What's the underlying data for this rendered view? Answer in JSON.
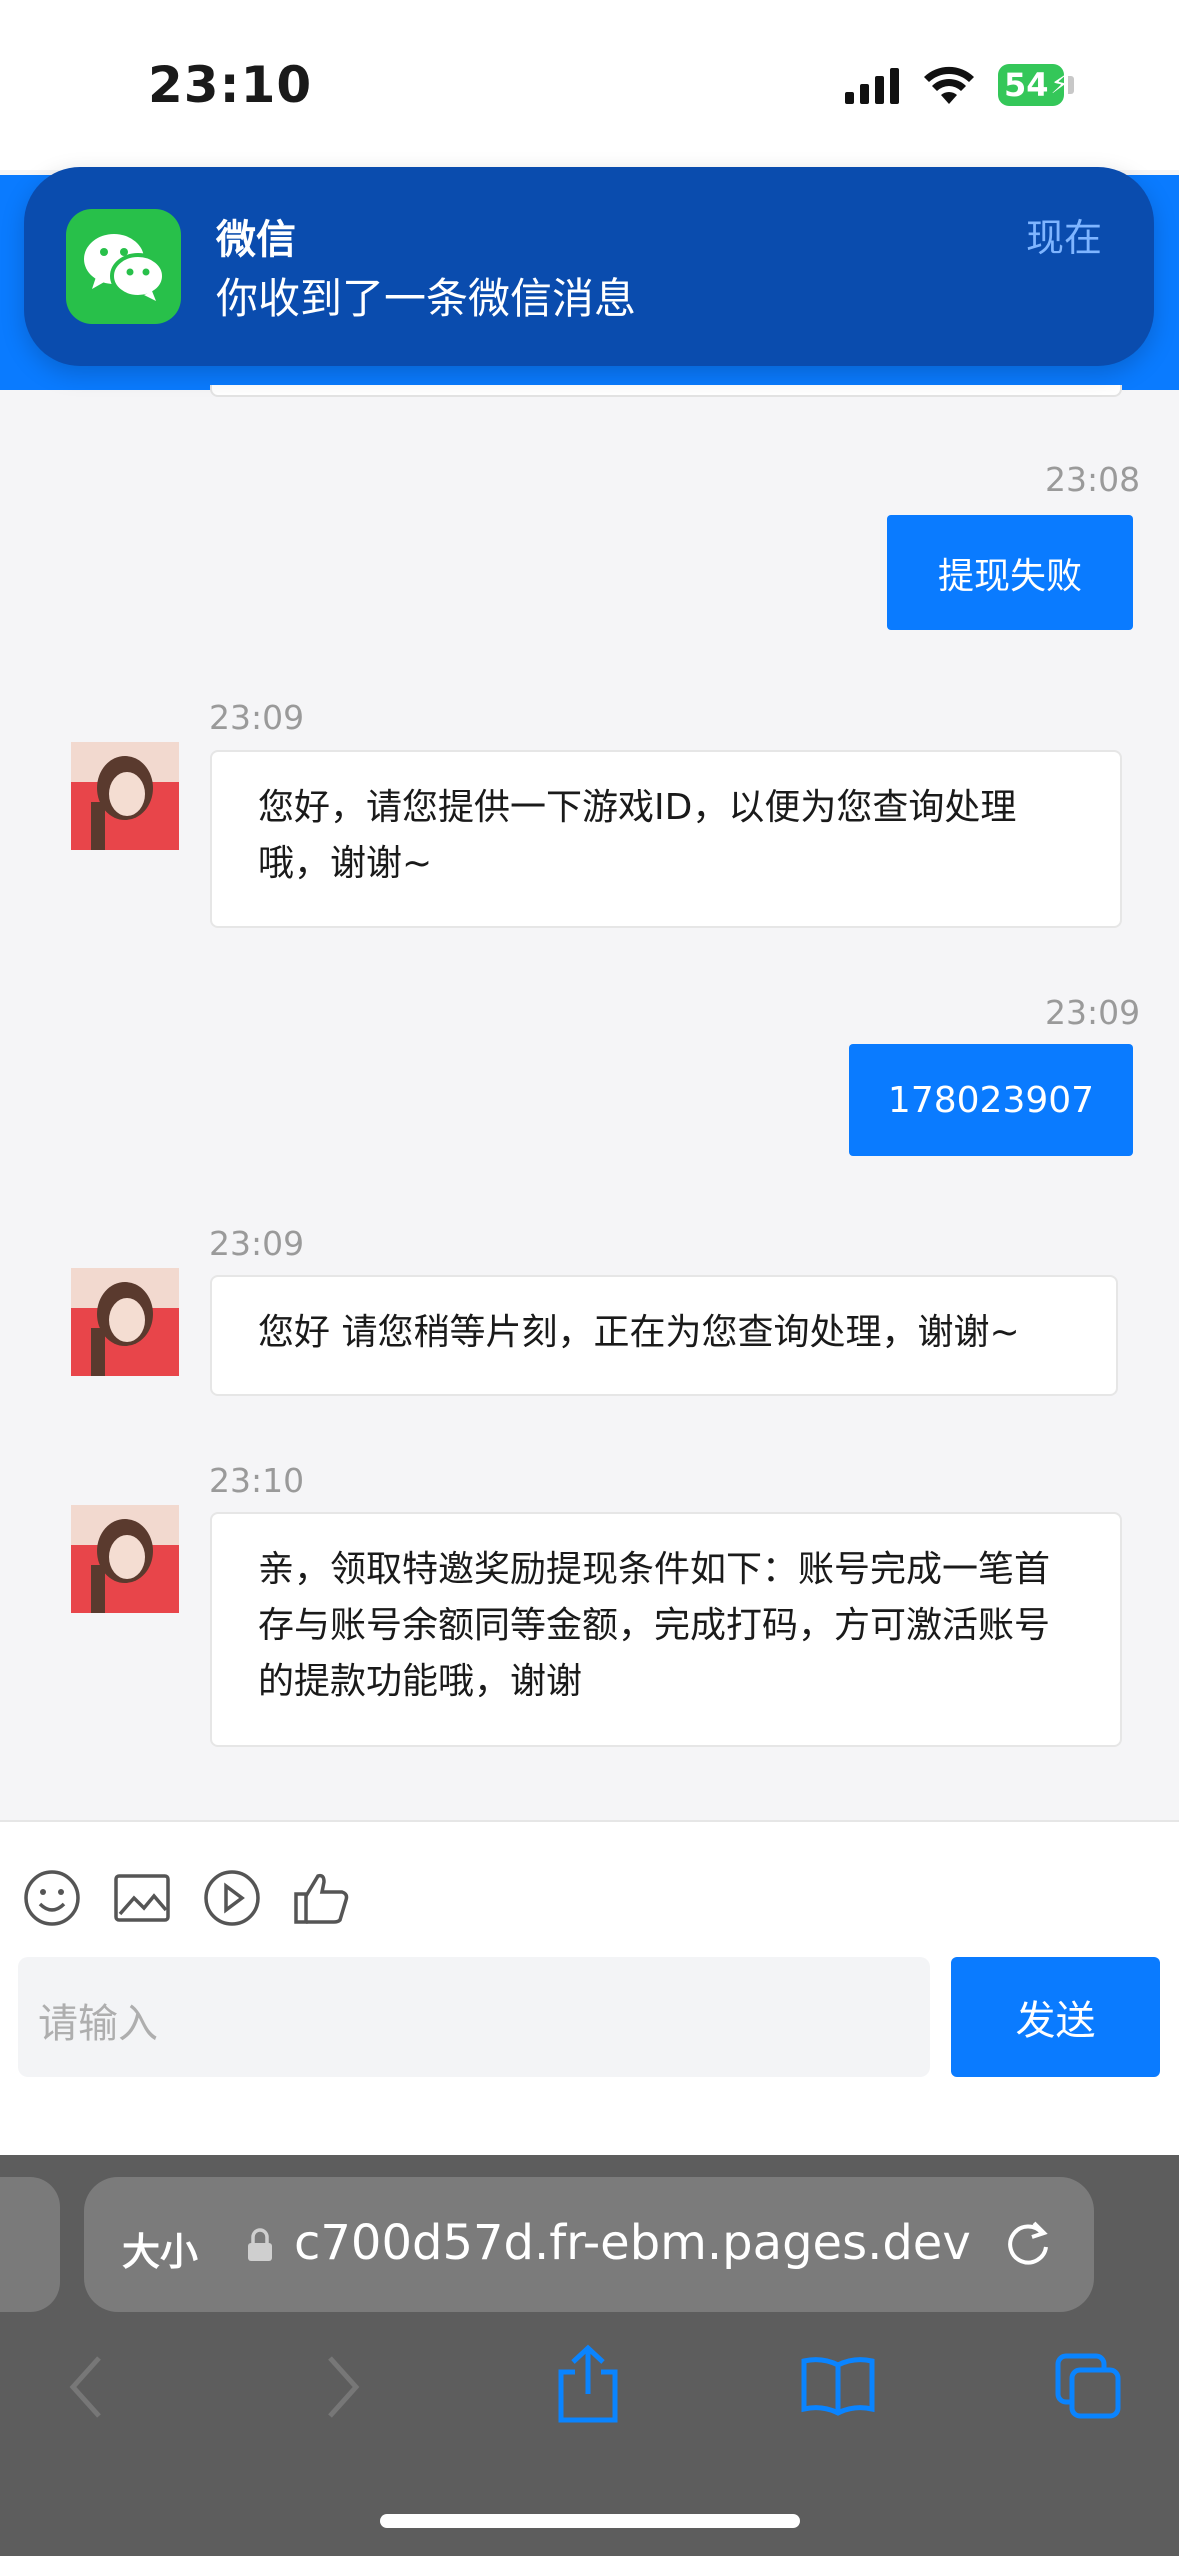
{
  "status": {
    "time": "23:10",
    "battery": "54"
  },
  "notification": {
    "app": "微信",
    "message": "你收到了一条微信消息",
    "time": "现在"
  },
  "messages": [
    {
      "time": "23:08",
      "text": "提现失败"
    },
    {
      "time": "23:09",
      "text": "您好，请您提供一下游戏ID，以便为您查询处理哦，谢谢~"
    },
    {
      "time": "23:09",
      "text": "178023907"
    },
    {
      "time": "23:09",
      "text": "您好 请您稍等片刻，正在为您查询处理，谢谢~"
    },
    {
      "time": "23:10",
      "text": "亲，领取特邀奖励提现条件如下：账号完成一笔首存与账号余额同等金额，完成打码，方可激活账号的提款功能哦，谢谢"
    }
  ],
  "composer": {
    "placeholder": "请输入",
    "send_label": "发送"
  },
  "browser": {
    "aa_label": "大小",
    "url": "c700d57d.fr-ebm.pages.dev"
  },
  "colors": {
    "accent": "#0a7bff",
    "notification_bg": "#0a4cae",
    "wechat_green": "#28c04a"
  }
}
